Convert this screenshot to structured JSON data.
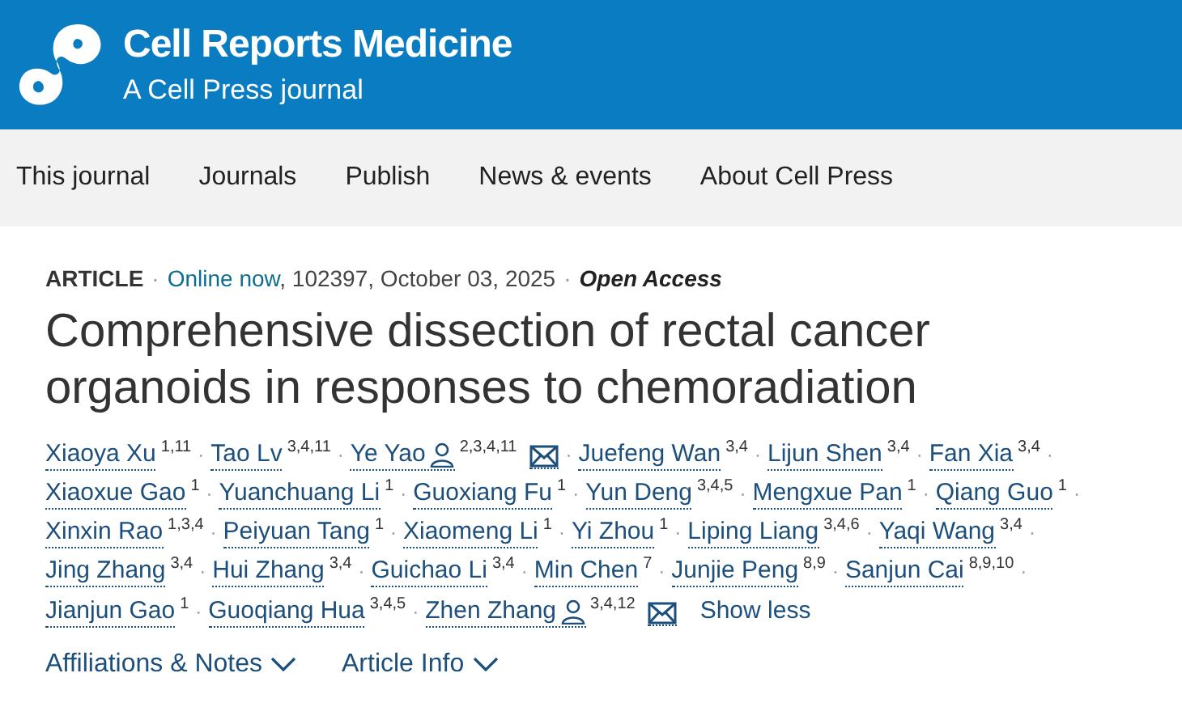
{
  "header": {
    "journal": "Cell Reports Medicine",
    "subtitle": "A Cell Press journal"
  },
  "nav": [
    "This journal",
    "Journals",
    "Publish",
    "News & events",
    "About Cell Press"
  ],
  "meta": {
    "type": "ARTICLE",
    "separator": "·",
    "status": "Online now",
    "details": ", 102397, October 03, 2025",
    "access": "Open Access"
  },
  "title": "Comprehensive dissection of rectal cancer organoids in responses to chemoradiation",
  "author_separator": "·",
  "author_lines": [
    [
      {
        "name": "Xiaoya Xu",
        "sup": "1,11",
        "corresponding": false
      },
      {
        "name": "Tao Lv",
        "sup": "3,4,11",
        "corresponding": false
      },
      {
        "name": "Ye Yao",
        "sup": "2,3,4,11",
        "corresponding": true
      },
      {
        "name": "Juefeng Wan",
        "sup": "3,4",
        "corresponding": false
      },
      {
        "name": "Lijun Shen",
        "sup": "3,4",
        "corresponding": false
      },
      {
        "name": "Fan Xia",
        "sup": "3,4",
        "corresponding": false
      }
    ],
    [
      {
        "name": "Xiaoxue Gao",
        "sup": "1",
        "corresponding": false
      },
      {
        "name": "Yuanchuang Li",
        "sup": "1",
        "corresponding": false
      },
      {
        "name": "Guoxiang Fu",
        "sup": "1",
        "corresponding": false
      },
      {
        "name": "Yun Deng",
        "sup": "3,4,5",
        "corresponding": false
      },
      {
        "name": "Mengxue Pan",
        "sup": "1",
        "corresponding": false
      },
      {
        "name": "Qiang Guo",
        "sup": "1",
        "corresponding": false
      }
    ],
    [
      {
        "name": "Xinxin Rao",
        "sup": "1,3,4",
        "corresponding": false
      },
      {
        "name": "Peiyuan Tang",
        "sup": "1",
        "corresponding": false
      },
      {
        "name": "Xiaomeng Li",
        "sup": "1",
        "corresponding": false
      },
      {
        "name": "Yi Zhou",
        "sup": "1",
        "corresponding": false
      },
      {
        "name": "Liping Liang",
        "sup": "3,4,6",
        "corresponding": false
      },
      {
        "name": "Yaqi Wang",
        "sup": "3,4",
        "corresponding": false
      }
    ],
    [
      {
        "name": "Jing Zhang",
        "sup": "3,4",
        "corresponding": false
      },
      {
        "name": "Hui Zhang",
        "sup": "3,4",
        "corresponding": false
      },
      {
        "name": "Guichao Li",
        "sup": "3,4",
        "corresponding": false
      },
      {
        "name": "Min Chen",
        "sup": "7",
        "corresponding": false
      },
      {
        "name": "Junjie Peng",
        "sup": "8,9",
        "corresponding": false
      },
      {
        "name": "Sanjun Cai",
        "sup": "8,9,10",
        "corresponding": false
      }
    ],
    [
      {
        "name": "Jianjun Gao",
        "sup": "1",
        "corresponding": false
      },
      {
        "name": "Guoqiang Hua",
        "sup": "3,4,5",
        "corresponding": false
      },
      {
        "name": "Zhen Zhang",
        "sup": "3,4,12",
        "corresponding": true
      }
    ]
  ],
  "show_less": "Show less",
  "expanders": [
    "Affiliations & Notes",
    "Article Info"
  ]
}
